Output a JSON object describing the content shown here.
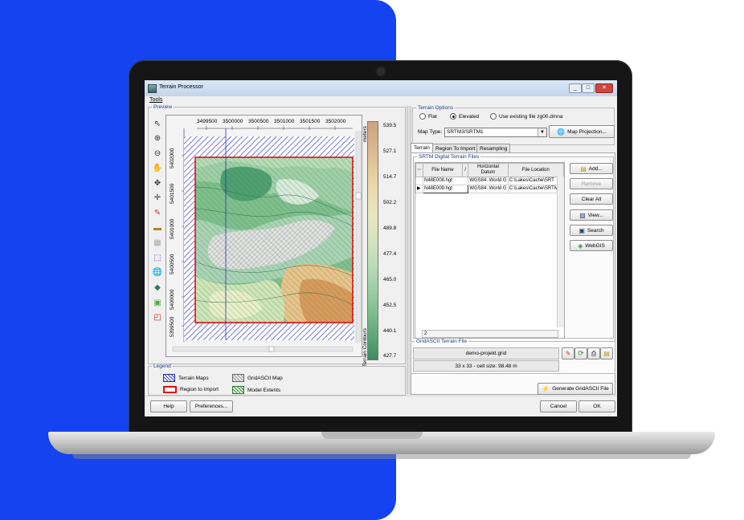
{
  "window": {
    "title": "Terrain Processor"
  },
  "menu": {
    "tools": "Tools"
  },
  "preview": {
    "legend": "Preview",
    "x_ticks": [
      "3499500",
      "3500000",
      "3500500",
      "3501000",
      "3501500",
      "3502000"
    ],
    "y_ticks": [
      "5402000",
      "5401500",
      "5401000",
      "5400500",
      "5400000",
      "5399500"
    ],
    "colorbar_ticks": [
      "539.5",
      "527.1",
      "514.7",
      "502.2",
      "489.8",
      "477.4",
      "465.0",
      "452.5",
      "440.1",
      "427.7"
    ],
    "colorbar_unit": "meters",
    "colorbar_title": "Terrain Contours",
    "colors": {
      "hatch": "#3c3cc8",
      "region": "#e01010"
    }
  },
  "legend": {
    "title": "Legend",
    "terrain_maps": "Terrain Maps",
    "region_to_import": "Region to Import",
    "gridascii_map": "GridASCII Map",
    "model_extents": "Model Extents"
  },
  "terrain_options": {
    "legend": "Terrain Options",
    "flat": "Flat",
    "elevated": "Elevated",
    "existing": "Use existing file zg00.dmna",
    "map_type_label": "Map Type:",
    "map_type_value": "SRTM3/SRTM1",
    "map_projection": "Map Projection..."
  },
  "tabs": [
    "Terrain",
    "Region To Import",
    "Resampling"
  ],
  "srtm": {
    "legend": "SRTM Digital Terrain Files",
    "columns": {
      "file_name": "File Name",
      "sort": "/",
      "datum": "Horizontal Datum",
      "location": "File Location"
    },
    "rows": [
      {
        "file": "N48E008.hgt",
        "datum": "WGS84: World G",
        "location": "C:\\Lakes\\Cache\\SRT"
      },
      {
        "file": "N48E009.hgt",
        "datum": "WGS84: World G",
        "location": "C:\\Lakes\\Cache\\SRTM"
      }
    ],
    "count": "2",
    "buttons": {
      "add": "Add...",
      "remove": "Remove",
      "clear_all": "Clear All",
      "view": "View...",
      "search": "Search",
      "webgis": "WebGIS"
    }
  },
  "gridascii": {
    "legend": "GridASCII Terrain File",
    "filename": "demo-projekt.grid",
    "info": "33 x 33 - cell size: 98.48 m"
  },
  "footer": {
    "generate": "Generate GridASCII File",
    "help": "Help",
    "preferences": "Preferences...",
    "cancel": "Cancel",
    "ok": "OK"
  }
}
